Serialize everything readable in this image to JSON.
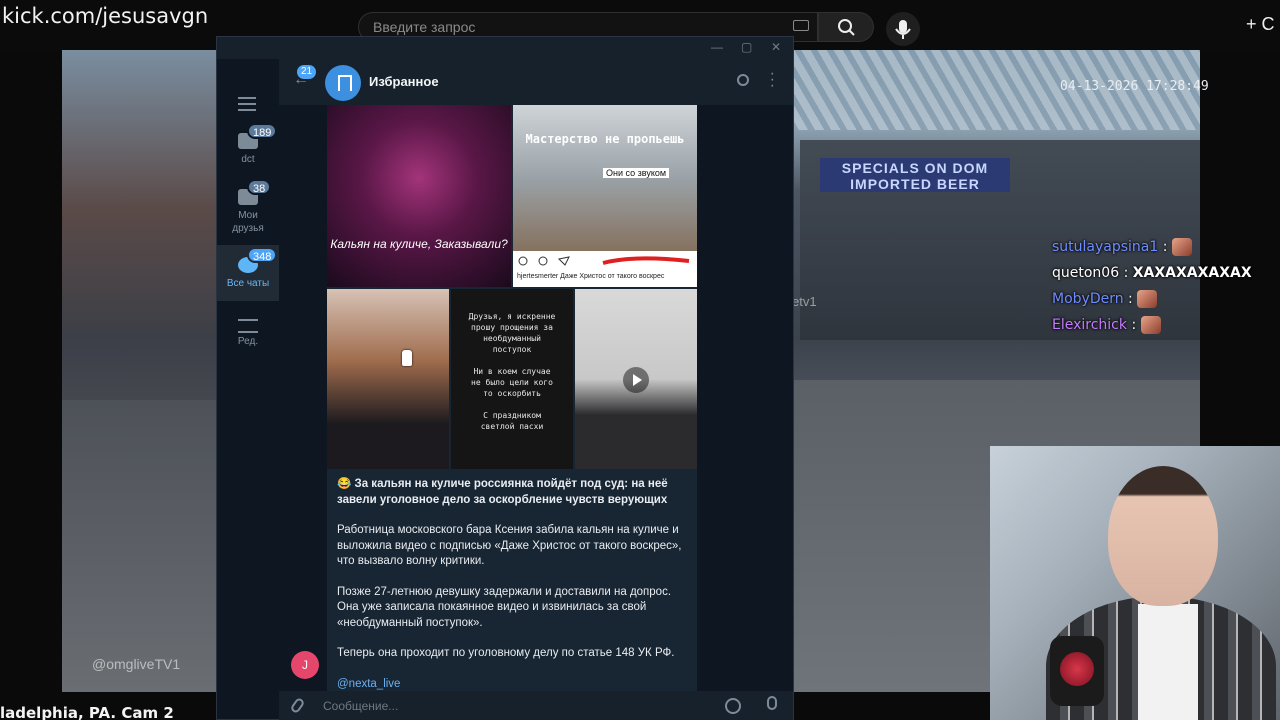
{
  "browser": {
    "url": "kick.com/jesusavgn",
    "search_placeholder": "Введите запрос",
    "create_label": "+ С"
  },
  "stream": {
    "timestamp": "04-13-2026 17:28:49",
    "caption": "ladelphia, PA. Cam 2",
    "watermark": "@omgliveTV1",
    "watermark2": "etv1",
    "store_sign": "SPECIALS ON DOM IMPORTED BEER"
  },
  "chat": [
    {
      "user": "sutulayapsina1",
      "color": "#6f8cff",
      "msg": "",
      "emote": true
    },
    {
      "user": "queton06",
      "color": "#ffffff",
      "msg": "ХАХАХАХАХАХ",
      "emote": false
    },
    {
      "user": "MobyDern",
      "color": "#6f8cff",
      "msg": "",
      "emote": true
    },
    {
      "user": "Elexirchick",
      "color": "#c57bff",
      "msg": "",
      "emote": true
    }
  ],
  "telegram": {
    "folders": [
      {
        "label": "dct",
        "badge": "189"
      },
      {
        "label": "Мои друзья",
        "badge": "38"
      },
      {
        "label": "Все чаты",
        "badge": "348",
        "active": true
      },
      {
        "label": "Ред.",
        "badge": ""
      }
    ],
    "back_badge": "21",
    "chat_title": "Избранное",
    "images": {
      "img1_text": "Кальян на куличе, Заказывали?",
      "img2_text": "Мастерство не пропьешь",
      "img2_sub": "Они со звуком",
      "img2_caption": "hjertesmerter Даже Христос от такого воскрес",
      "img4_text": "Друзья, я искренне\nпрошу прощения за\nнеобдуманный\nпоступок\n\nНи в коем случае\nне было цели кого\nто оскорбить\n\nС праздником\nсветлой пасхи"
    },
    "post": {
      "headline": "😂 За кальян на куличе россиянка пойдёт под суд: на неё завели уголовное дело за оскорбление чувств верующих",
      "p1": "Работница московского бара Ксения забила кальян на куличе и выложила видео с подписью «Даже Христос от такого воскрес», что вызвало волну критики.",
      "p2": "Позже 27-летнюю девушку задержали и доставили на допрос. Она уже записала покаянное видео и извинилась за свой «необдуманный поступок».",
      "p3": "Теперь она проходит по уголовному делу по статье 148 УК РФ.",
      "link": "@nexta_live"
    },
    "sender_initial": "J",
    "input_placeholder": "Сообщение..."
  }
}
